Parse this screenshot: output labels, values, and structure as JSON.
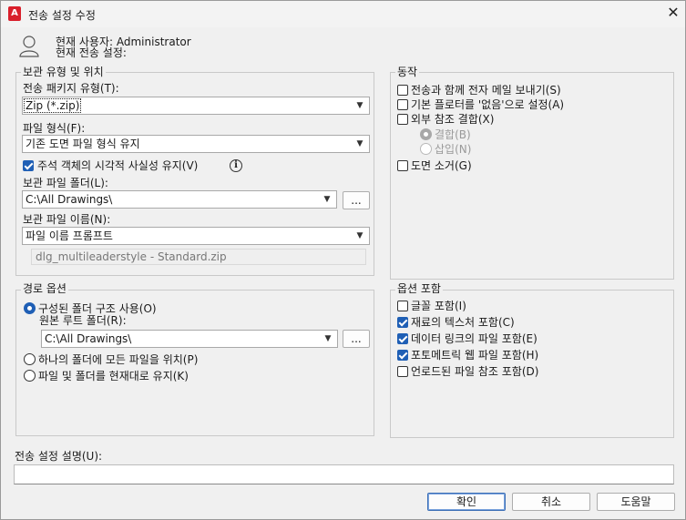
{
  "window": {
    "title": "전송 설정 수정",
    "app_icon": "A"
  },
  "header": {
    "current_user": "현재 사용자: Administrator",
    "current_setup": "현재 전송 설정:"
  },
  "archive": {
    "legend": "보관 유형 및 위치",
    "package_type_label": "전송 패키지 유형(T):",
    "package_type_value": "Zip (*.zip)",
    "file_format_label": "파일 형식(F):",
    "file_format_value": "기존 도면 파일 형식 유지",
    "maintain_visual_label": "주석 객체의 시각적 사실성 유지(V)",
    "maintain_visual_checked": true,
    "folder_label": "보관 파일 폴더(L):",
    "folder_value": "C:\\All Drawings\\",
    "browse_label": "...",
    "name_label": "보관 파일 이름(N):",
    "name_value": "파일 이름 프롬프트",
    "name_preview": "dlg_multileaderstyle - Standard.zip"
  },
  "path_options": {
    "legend": "경로 옵션",
    "organized_label": "구성된 폴더 구조 사용(O)",
    "source_root_label": "원본 루트 폴더(R):",
    "source_root_value": "C:\\All Drawings\\",
    "browse_label": "...",
    "single_folder_label": "하나의 폴더에 모든 파일을 위치(P)",
    "keep_as_is_label": "파일 및 폴더를 현재대로 유지(K)",
    "selected": "organized"
  },
  "actions": {
    "legend": "동작",
    "send_email": {
      "label": "전송과 함께 전자 메일 보내기(S)",
      "checked": false
    },
    "default_plotter": {
      "label": "기본 플로터를 '없음'으로 설정(A)",
      "checked": false
    },
    "bind_xref": {
      "label": "외부 참조 결합(X)",
      "checked": false
    },
    "bind_option": {
      "label": "결합(B)",
      "selected": true
    },
    "insert_option": {
      "label": "삽입(N)",
      "selected": false
    },
    "purge": {
      "label": "도면 소거(G)",
      "checked": false
    }
  },
  "include": {
    "legend": "옵션 포함",
    "fonts": {
      "label": "글꼴 포함(I)",
      "checked": false
    },
    "textures": {
      "label": "재료의 텍스처 포함(C)",
      "checked": true
    },
    "data_links": {
      "label": "데이터 링크의 파일 포함(E)",
      "checked": true
    },
    "photometric": {
      "label": "포토메트릭 웹 파일 포함(H)",
      "checked": true
    },
    "unloaded_refs": {
      "label": "언로드된 파일 참조 포함(D)",
      "checked": false
    }
  },
  "description": {
    "label": "전송 설정 설명(U):",
    "value": ""
  },
  "buttons": {
    "ok": "확인",
    "cancel": "취소",
    "help": "도움말"
  }
}
